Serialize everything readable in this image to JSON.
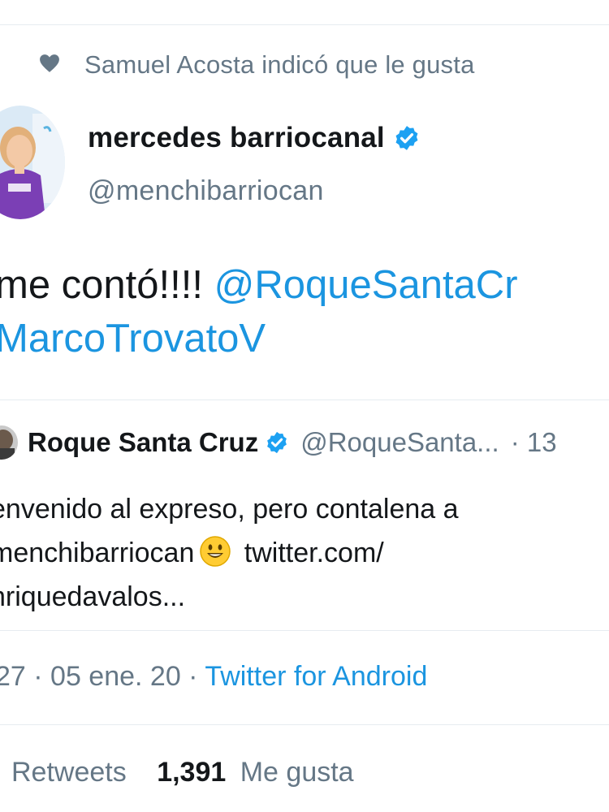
{
  "social_context": {
    "icon": "heart-icon",
    "text": "Samuel Acosta indicó que le gusta"
  },
  "author": {
    "name": "mercedes barriocanal",
    "handle": "@menchibarriocan",
    "verified": true
  },
  "tweet": {
    "text_plain": "me contó!!!! ",
    "mention1": "@RoqueSantaCr",
    "mention2": "MarcoTrovatoV"
  },
  "quoted": {
    "name": "Roque Santa Cruz",
    "handle": "@RoqueSanta...",
    "time": "· 13",
    "line1": "envenido al expreso, pero contalena a",
    "line2_mention": "menchibarriocan",
    "line2_link": " twitter.com/",
    "line3": "nriquedavalos..."
  },
  "meta": {
    "time": "27 · 05 ene. 20 · ",
    "source": "Twitter for Android"
  },
  "stats": {
    "retweets_label": "Retweets",
    "likes_count": "1,391",
    "likes_label": "Me gusta"
  },
  "colors": {
    "link": "#1b95e0",
    "secondary": "#657786",
    "divider": "#e6ecf0",
    "verified": "#1da1f2"
  }
}
